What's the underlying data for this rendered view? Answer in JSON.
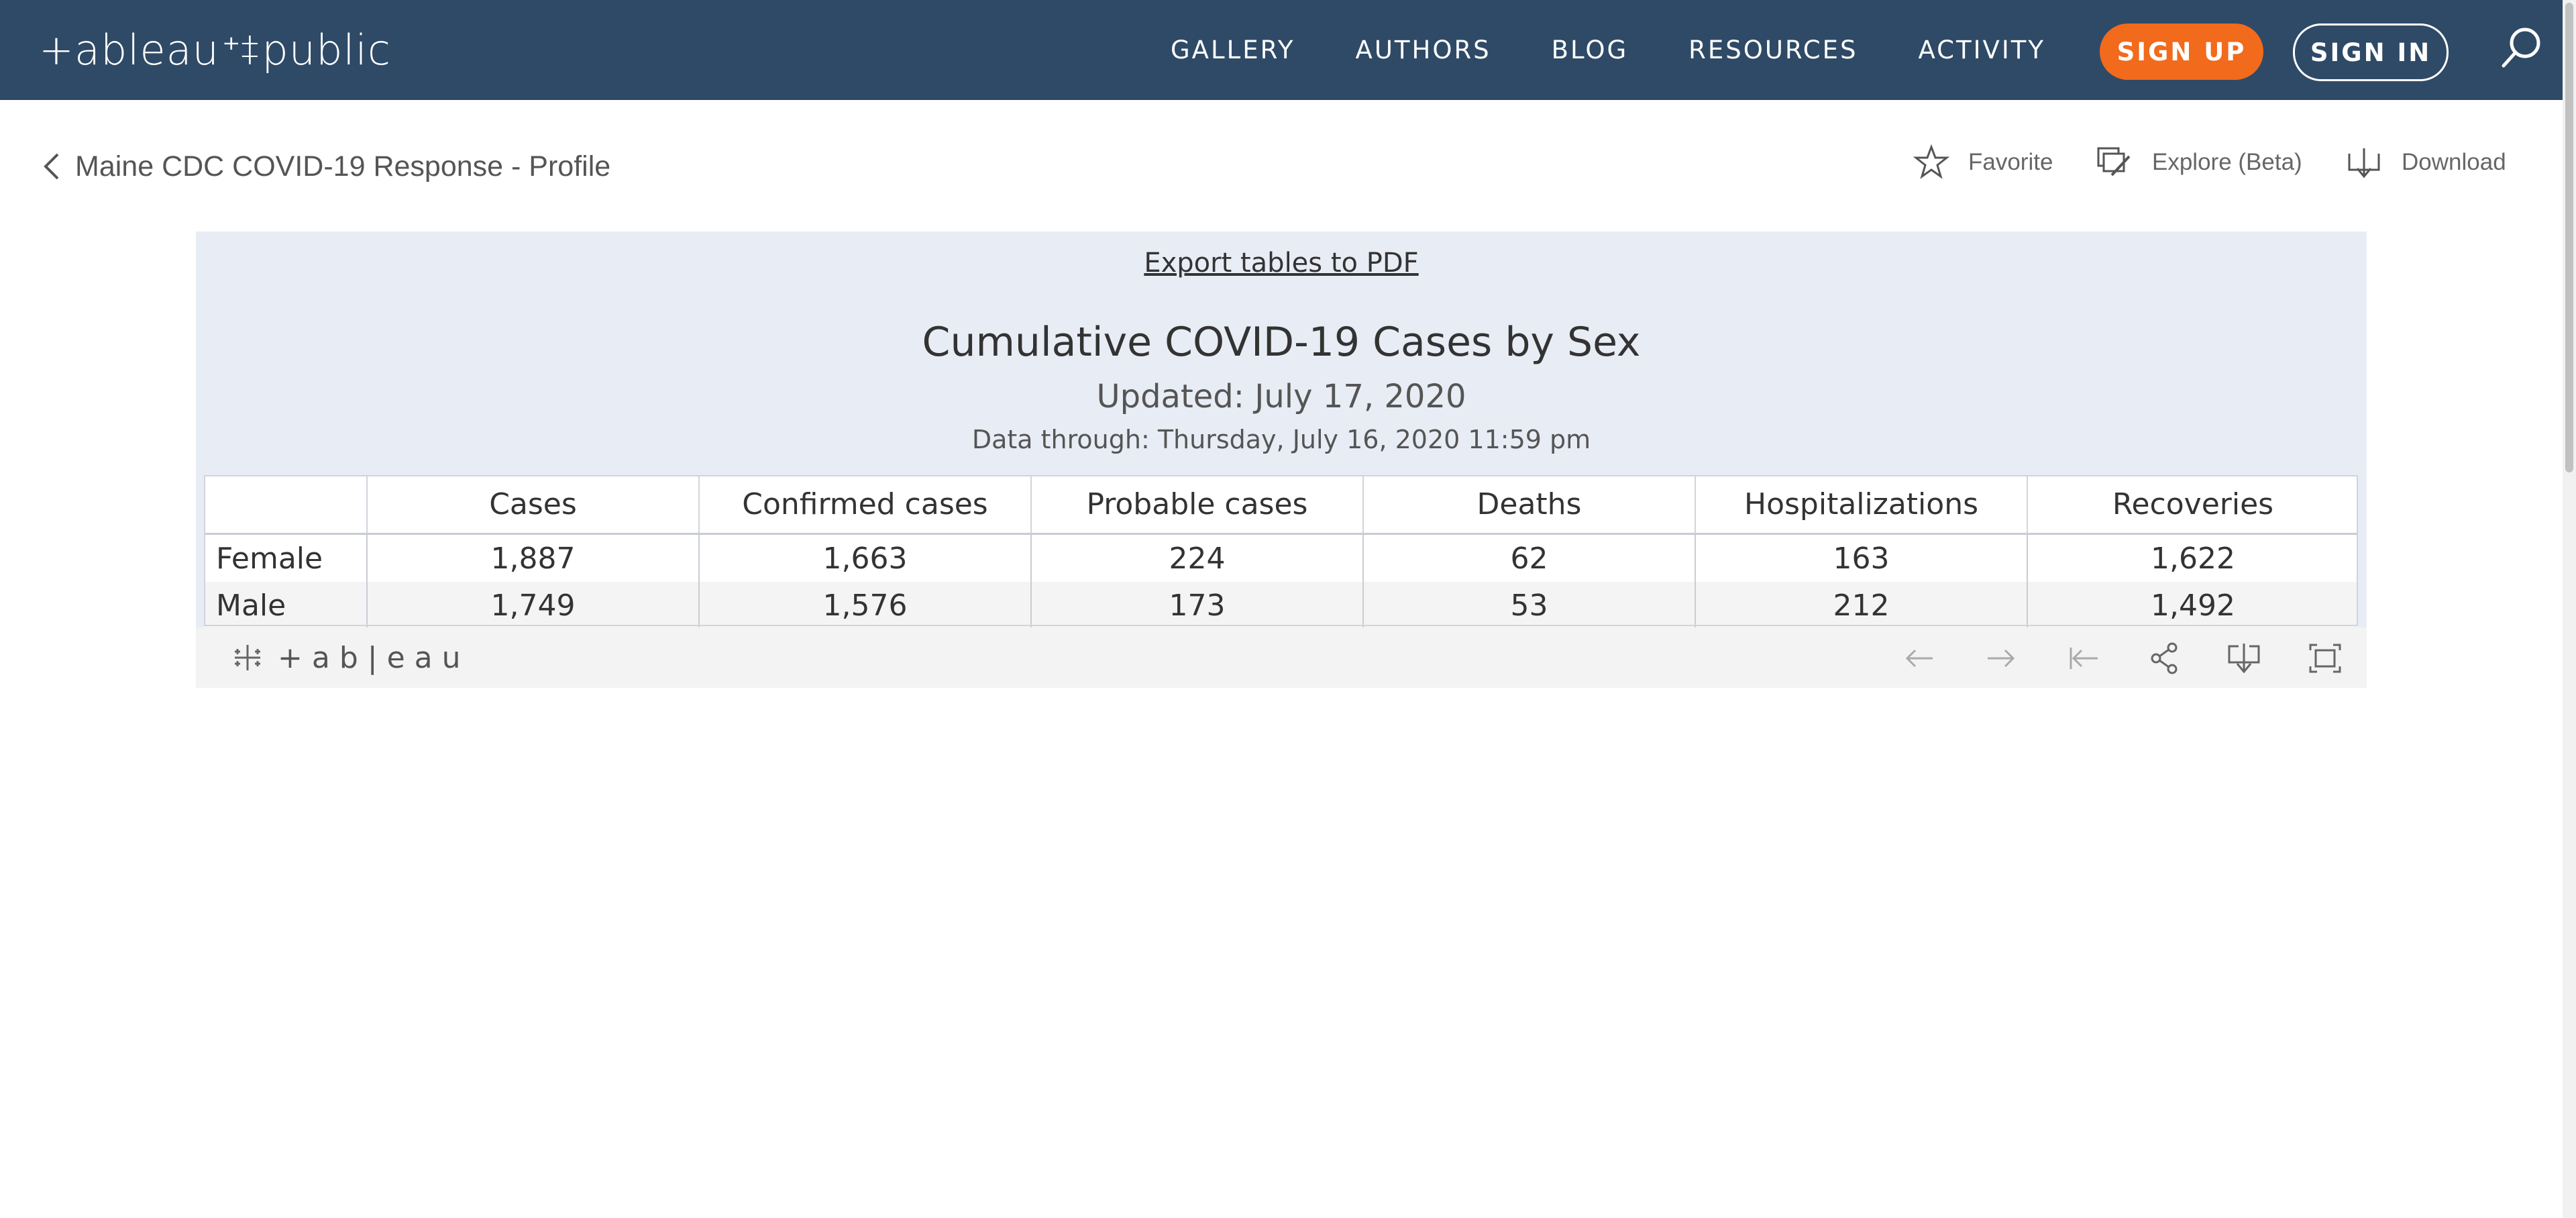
{
  "nav": {
    "logo_left": "+ableau",
    "logo_right": "public",
    "links": [
      "GALLERY",
      "AUTHORS",
      "BLOG",
      "RESOURCES",
      "ACTIVITY"
    ],
    "signup": "SIGN UP",
    "signin": "SIGN IN"
  },
  "breadcrumb": {
    "title": "Maine CDC COVID-19 Response - Profile"
  },
  "actions": {
    "favorite": "Favorite",
    "explore": "Explore (Beta)",
    "download": "Download"
  },
  "viz": {
    "export_link": "Export tables to PDF",
    "title": "Cumulative COVID-19 Cases by Sex",
    "updated": "Updated: July 17, 2020",
    "data_through": "Data through: Thursday, July 16, 2020 11:59 pm",
    "table": {
      "columns": [
        "",
        "Cases",
        "Confirmed cases",
        "Probable cases",
        "Deaths",
        "Hospitalizations",
        "Recoveries"
      ],
      "rows": [
        [
          "Female",
          "1,887",
          "1,663",
          "224",
          "62",
          "163",
          "1,622"
        ],
        [
          "Male",
          "1,749",
          "1,576",
          "173",
          "53",
          "212",
          "1,492"
        ]
      ]
    }
  },
  "toolbar": {
    "logo_text": "+ab|eau"
  },
  "colors": {
    "nav_bg": "#2f4a66",
    "signup_bg": "#f26a1b",
    "viz_bg": "#e8ecf5"
  }
}
